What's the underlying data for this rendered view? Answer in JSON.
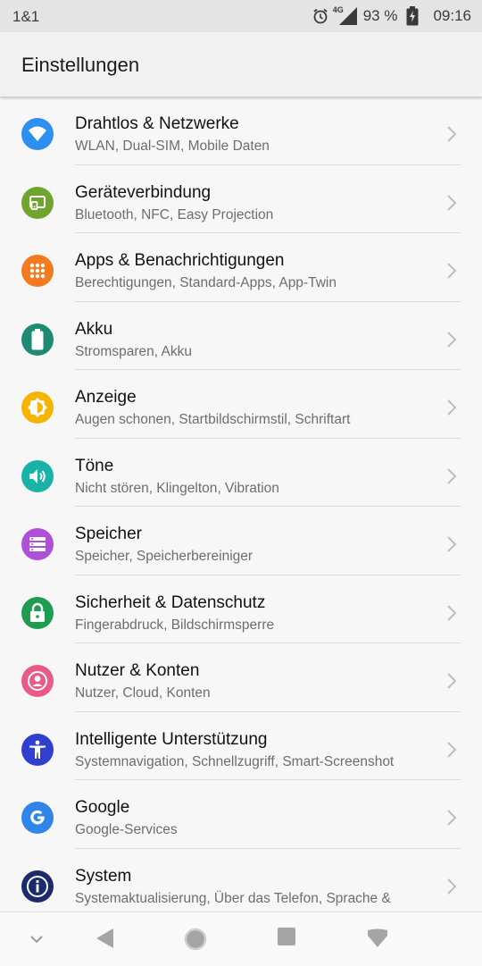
{
  "status_bar": {
    "carrier": "1&1",
    "network_type": "4G",
    "battery_percent": "93 %",
    "time": "09:16",
    "icons": [
      "alarm-icon",
      "signal-icon",
      "battery-charging-icon"
    ]
  },
  "app_bar": {
    "title": "Einstellungen"
  },
  "settings": [
    {
      "title": "Drahtlos & Netzwerke",
      "subtitle": "WLAN, Dual-SIM, Mobile Daten",
      "icon": "wifi-icon",
      "color": "#2d8ff0"
    },
    {
      "title": "Geräteverbindung",
      "subtitle": "Bluetooth, NFC, Easy Projection",
      "icon": "device-connection-icon",
      "color": "#6fa52d"
    },
    {
      "title": "Apps & Benachrichtigungen",
      "subtitle": "Berechtigungen, Standard-Apps, App-Twin",
      "icon": "apps-grid-icon",
      "color": "#f47a1f"
    },
    {
      "title": "Akku",
      "subtitle": "Stromsparen, Akku",
      "icon": "battery-icon",
      "color": "#1f8a72"
    },
    {
      "title": "Anzeige",
      "subtitle": "Augen schonen, Startbildschirmstil, Schriftart",
      "icon": "brightness-icon",
      "color": "#f5b400"
    },
    {
      "title": "Töne",
      "subtitle": "Nicht stören, Klingelton, Vibration",
      "icon": "volume-icon",
      "color": "#18b2a6"
    },
    {
      "title": "Speicher",
      "subtitle": "Speicher, Speicherbereiniger",
      "icon": "storage-icon",
      "color": "#b04fd8"
    },
    {
      "title": "Sicherheit & Datenschutz",
      "subtitle": "Fingerabdruck, Bildschirmsperre",
      "icon": "lock-icon",
      "color": "#1e9c4f"
    },
    {
      "title": "Nutzer & Konten",
      "subtitle": "Nutzer, Cloud, Konten",
      "icon": "user-icon",
      "color": "#e95a86"
    },
    {
      "title": "Intelligente Unterstützung",
      "subtitle": "Systemnavigation, Schnellzugriff, Smart-Screenshot",
      "icon": "accessibility-icon",
      "color": "#2f3fd0"
    },
    {
      "title": "Google",
      "subtitle": "Google-Services",
      "icon": "google-icon",
      "color": "#2f86e8"
    },
    {
      "title": "System",
      "subtitle": "Systemaktualisierung, Über das Telefon, Sprache &",
      "icon": "info-icon",
      "color": "#1c2b6b"
    }
  ],
  "nav_bar": {
    "buttons": [
      "hide-nav-icon",
      "back-icon",
      "home-icon",
      "recents-icon",
      "notifications-pull-icon"
    ]
  }
}
